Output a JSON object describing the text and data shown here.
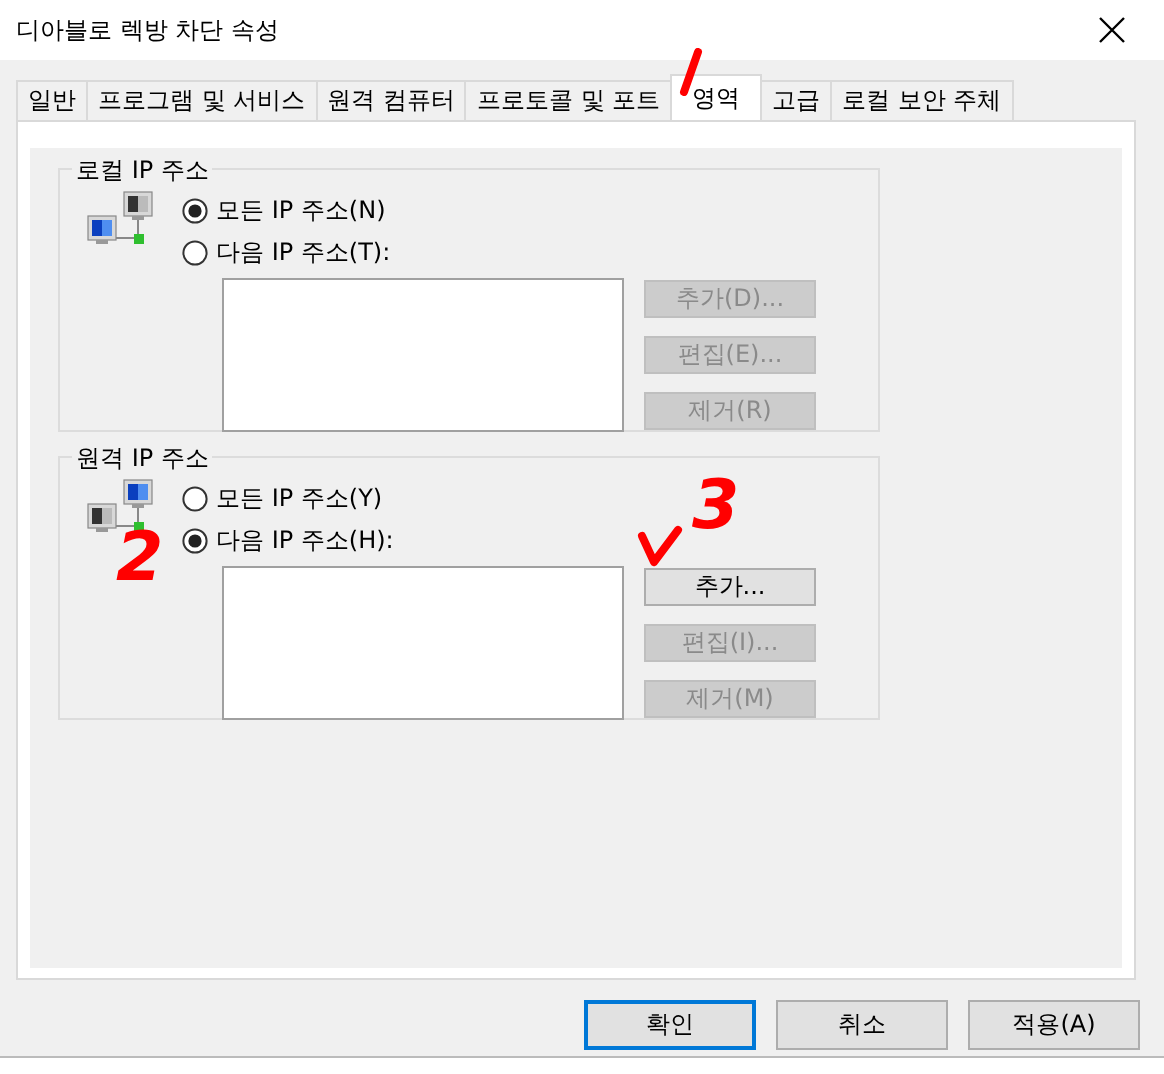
{
  "window": {
    "title": "디아블로 렉방 차단 속성"
  },
  "tabs": [
    {
      "label": "일반",
      "selected": false
    },
    {
      "label": "프로그램 및 서비스",
      "selected": false
    },
    {
      "label": "원격 컴퓨터",
      "selected": false
    },
    {
      "label": "프로토콜 및 포트",
      "selected": false
    },
    {
      "label": "영역",
      "selected": true
    },
    {
      "label": "고급",
      "selected": false
    },
    {
      "label": "로컬 보안 주체",
      "selected": false
    }
  ],
  "groups": [
    {
      "title": "로컬 IP 주소",
      "kind": "local",
      "options": [
        {
          "label": "모든 IP 주소(N)",
          "selected": true
        },
        {
          "label": "다음 IP 주소(T):",
          "selected": false
        }
      ],
      "buttons": [
        {
          "label": "추가(D)...",
          "disabled": true
        },
        {
          "label": "편집(E)...",
          "disabled": true
        },
        {
          "label": "제거(R)",
          "disabled": true
        }
      ]
    },
    {
      "title": "원격 IP 주소",
      "kind": "remote",
      "options": [
        {
          "label": "모든 IP 주소(Y)",
          "selected": false
        },
        {
          "label": "다음 IP 주소(H):",
          "selected": true
        }
      ],
      "buttons": [
        {
          "label": "추가...",
          "disabled": false
        },
        {
          "label": "편집(I)...",
          "disabled": true
        },
        {
          "label": "제거(M)",
          "disabled": true
        }
      ]
    }
  ],
  "dialog_buttons": [
    {
      "label": "확인",
      "default": true
    },
    {
      "label": "취소",
      "default": false
    },
    {
      "label": "적용(A)",
      "default": false
    }
  ],
  "annotations": [
    {
      "kind": "stroke"
    },
    {
      "kind": "digit",
      "text": "2"
    },
    {
      "kind": "check"
    },
    {
      "kind": "digit",
      "text": "3"
    }
  ]
}
